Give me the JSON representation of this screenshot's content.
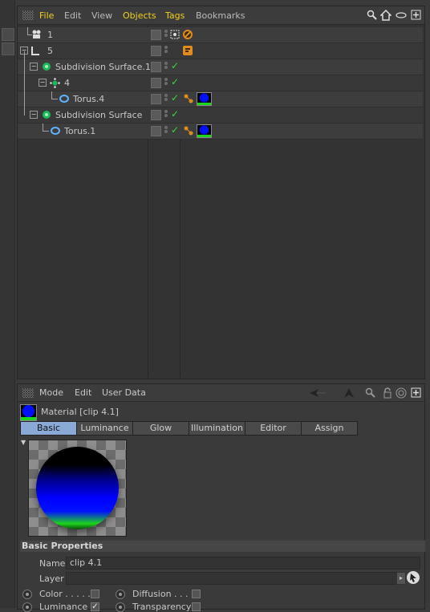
{
  "object_manager": {
    "menu": [
      "File",
      "Edit",
      "View",
      "Objects",
      "Tags",
      "Bookmarks"
    ],
    "rows": [
      {
        "name": "1"
      },
      {
        "name": "5"
      },
      {
        "name": "Subdivision Surface.1"
      },
      {
        "name": "4"
      },
      {
        "name": "Torus.4"
      },
      {
        "name": "Subdivision Surface"
      },
      {
        "name": "Torus.1"
      }
    ],
    "toolbar_icons": [
      "search-icon",
      "home-icon",
      "eye-icon",
      "new-panel-icon"
    ]
  },
  "attribute_manager": {
    "menu": [
      "Mode",
      "Edit",
      "User Data"
    ],
    "title": "Material [clip 4.1]",
    "tabs": [
      "Basic",
      "Luminance",
      "Glow",
      "Illumination",
      "Editor",
      "Assign"
    ],
    "active_tab": "Basic",
    "section": "Basic Properties",
    "name_label": "Name",
    "name_value": "clip 4.1",
    "layer_label": "Layer",
    "layer_value": "",
    "channels": [
      {
        "label": "Color . . . . .",
        "checked": false
      },
      {
        "label": "Diffusion . . .",
        "checked": false
      },
      {
        "label": "Luminance",
        "checked": true
      },
      {
        "label": "Transparency",
        "checked": false
      }
    ]
  },
  "colors": {
    "accent": "#8aa9d6",
    "highlight_text": "#f0d020",
    "check": "#3fd43f"
  }
}
